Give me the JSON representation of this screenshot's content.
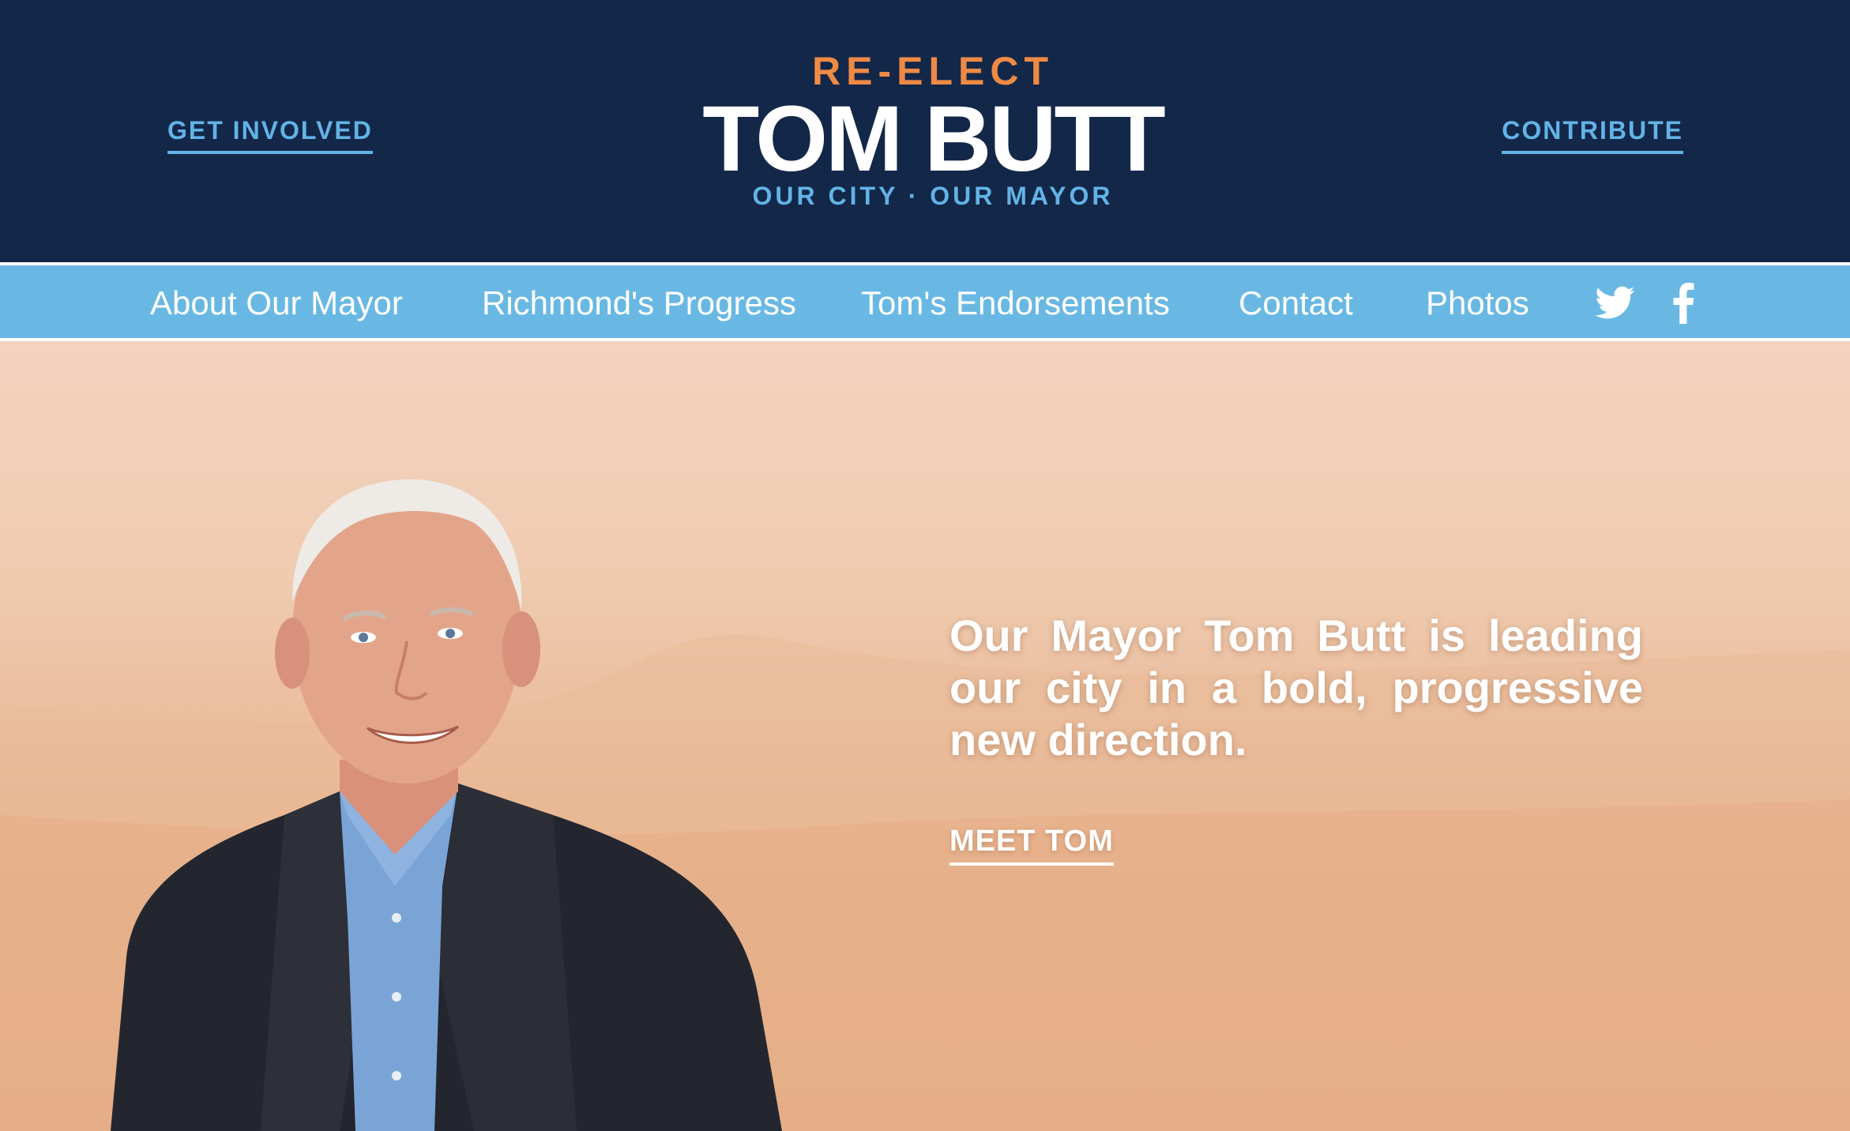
{
  "header": {
    "get_involved_label": "GET INVOLVED",
    "contribute_label": "CONTRIBUTE",
    "logo": {
      "top_line": "RE-ELECT",
      "name": "TOM BUTT",
      "tagline": "OUR CITY · OUR MAYOR"
    }
  },
  "nav": {
    "items": [
      {
        "label": "About Our Mayor"
      },
      {
        "label": "Richmond's Progress"
      },
      {
        "label": "Tom's Endorsements"
      },
      {
        "label": "Contact"
      },
      {
        "label": "Photos"
      }
    ],
    "icons": [
      "twitter-icon",
      "facebook-icon"
    ]
  },
  "hero": {
    "headline": "Our Mayor Tom Butt is leading our city in a bold, progressive new direction.",
    "cta_label": "MEET TOM",
    "image": "portrait of Tom Butt"
  },
  "colors": {
    "header_bg": "#132749",
    "accent_blue": "#63b3e6",
    "accent_orange": "#ef8a45",
    "nav_bg": "#69b8e4",
    "hero_top": "#f3d3c0",
    "hero_bottom": "#e2a47b"
  }
}
